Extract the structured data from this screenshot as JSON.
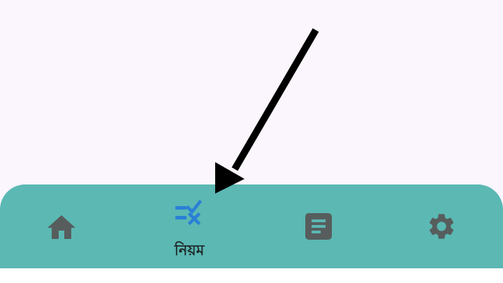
{
  "bottom_nav": {
    "items": [
      {
        "id": "home",
        "icon": "home-icon",
        "label": "",
        "selected": false
      },
      {
        "id": "rules",
        "icon": "rule-icon",
        "label": "নিয়ম",
        "selected": true
      },
      {
        "id": "notes",
        "icon": "article-icon",
        "label": "",
        "selected": false
      },
      {
        "id": "settings",
        "icon": "gear-icon",
        "label": "",
        "selected": false
      }
    ]
  },
  "colors": {
    "background": "#fbf5fd",
    "nav_bar": "#5bb8b3",
    "inactive_icon": "#575d5d",
    "active_icon": "#2a7fd6",
    "arrow": "#000000"
  }
}
